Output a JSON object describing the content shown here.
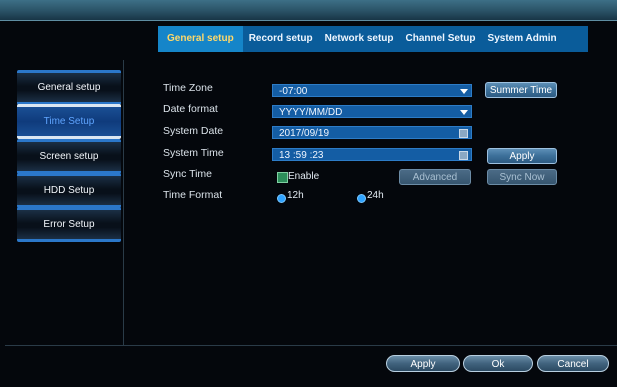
{
  "tabs": [
    {
      "label": "General setup"
    },
    {
      "label": "Record setup"
    },
    {
      "label": "Network setup"
    },
    {
      "label": "Channel Setup"
    },
    {
      "label": "System Admin"
    }
  ],
  "sidebar": {
    "items": [
      {
        "label": "General setup"
      },
      {
        "label": "Time Setup"
      },
      {
        "label": "Screen setup"
      },
      {
        "label": "HDD Setup"
      },
      {
        "label": "Error Setup"
      }
    ]
  },
  "form": {
    "time_zone": {
      "label": "Time Zone",
      "value": "-07:00"
    },
    "date_format": {
      "label": "Date format",
      "value": "YYYY/MM/DD"
    },
    "system_date": {
      "label": "System Date",
      "value": "2017/09/19"
    },
    "system_time": {
      "label": "System Time",
      "value": "13 :59 :23"
    },
    "sync_time": {
      "label": "Sync Time",
      "enable_label": "Enable"
    },
    "time_format": {
      "label": "Time Format",
      "opt_12h": "12h",
      "opt_24h": "24h"
    }
  },
  "buttons": {
    "summer_time": "Summer Time",
    "apply": "Apply",
    "advanced": "Advanced",
    "sync_now": "Sync Now"
  },
  "footer": {
    "apply": "Apply",
    "ok": "Ok",
    "cancel": "Cancel"
  },
  "colors": {
    "accent": "#1585c9",
    "active_tab_text": "#ffd96a"
  }
}
